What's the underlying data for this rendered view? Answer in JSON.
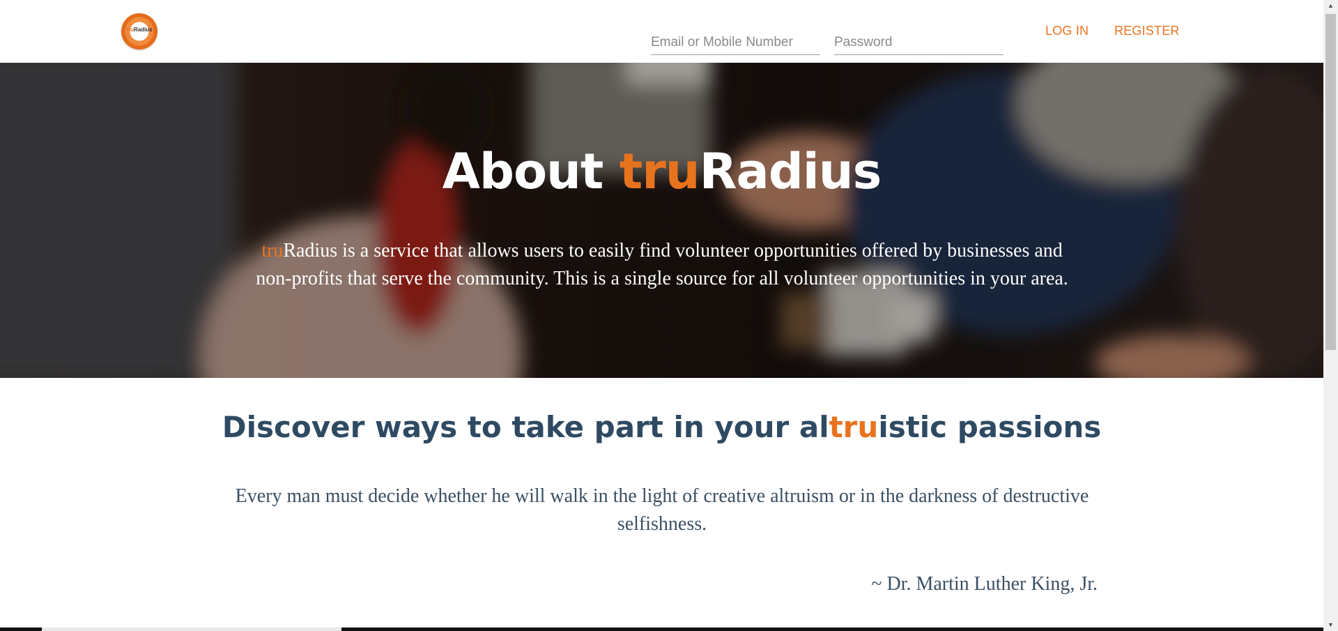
{
  "header": {
    "logo": {
      "tru": "tru",
      "rest": "Radius"
    },
    "email_placeholder": "Email or Mobile Number",
    "password_placeholder": "Password",
    "login_label": "LOG IN",
    "register_label": "REGISTER",
    "accent_color": "#e8731f"
  },
  "hero": {
    "title_prefix": "About ",
    "title_accent": "tru",
    "title_suffix": "Radius",
    "desc_accent": "tru",
    "desc_line1_rest": "Radius is a service that allows users to easily find volunteer opportunities offered by businesses and",
    "desc_line2": "non-profits that serve the community. This is a single source for all volunteer opportunities in your area."
  },
  "main": {
    "headline_prefix": "Discover ways to take part in your al",
    "headline_accent": "tru",
    "headline_suffix": "istic passions",
    "quote": "Every man must decide whether he will walk in the light of creative altruism or in the darkness of destructive selfishness.",
    "author": "~ Dr. Martin Luther King, Jr.",
    "text_color": "#2e4a63"
  }
}
